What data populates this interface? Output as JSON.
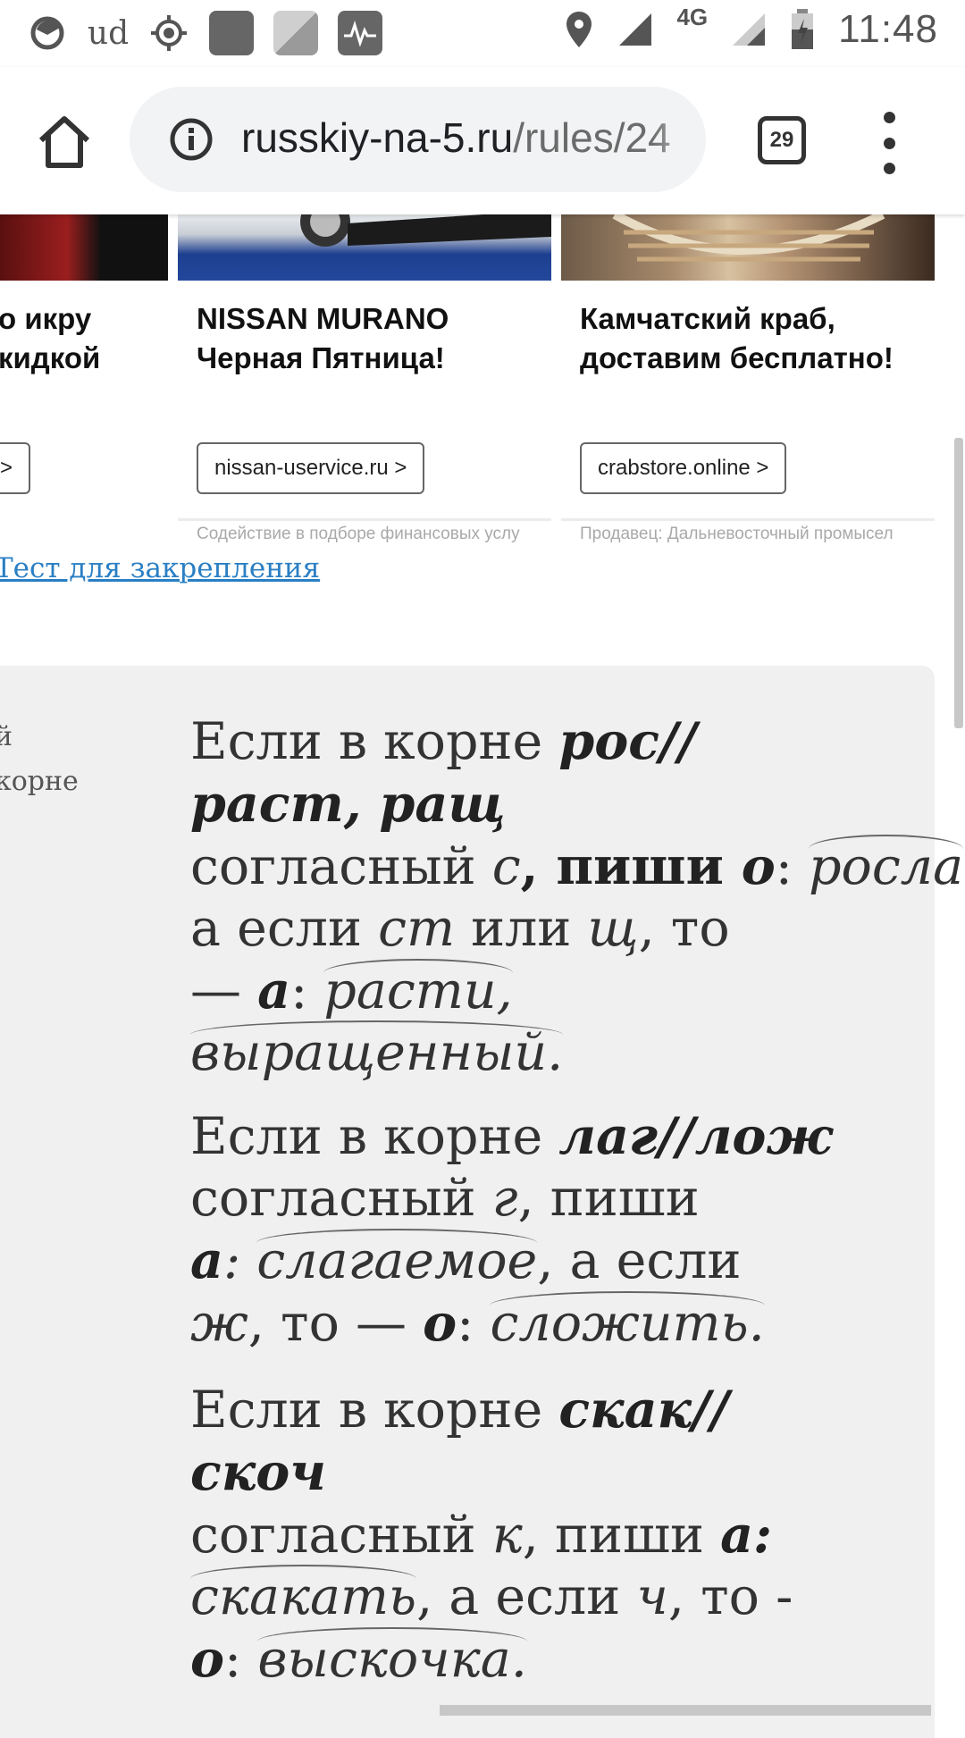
{
  "status_bar": {
    "network": "4G",
    "time": "11:48"
  },
  "toolbar": {
    "url_host": "russkiy-na-5.ru",
    "url_path": "/rules/24",
    "tab_count": "29"
  },
  "ads": [
    {
      "title_line1": "о икру",
      "title_line2": "кидкой",
      "button": ">",
      "note": ""
    },
    {
      "title_line1": "NISSAN MURANO",
      "title_line2": "Черная Пятница!",
      "button": "nissan-uservice.ru >",
      "note": "Содействие в подборе финансовых услу"
    },
    {
      "title_line1": "Камчатский краб,",
      "title_line2": "доставим бесплатно!",
      "button": "crabstore.online >",
      "note": "Продавец: Дальневосточный промысел"
    }
  ],
  "test_link": "Тест для закрепления",
  "left_column": {
    "line1": "й",
    "line2": "корне"
  },
  "rules": {
    "r1": {
      "l1_plain": "Если в корне  ",
      "l1_bold": "рос//",
      "l2_bold": "раст, ращ",
      "l3_a": "согласный ",
      "l3_b": "с",
      "l3_c": ", пиши ",
      "l3_d": "о",
      "l3_e": ": ",
      "l3_f": "росла",
      "l4_a": "а если ",
      "l4_b": "ст",
      "l4_c": " или ",
      "l4_d": "щ",
      "l4_e": ", то",
      "l5_a": " — ",
      "l5_b": "а",
      "l5_c": ": ",
      "l5_d": "расти,",
      "l6_a": "выращенный."
    },
    "r2": {
      "l1_plain": "Если в корне ",
      "l1_bold": "лаг//лож",
      "l2_a": "согласный ",
      "l2_b": "г",
      "l2_c": ", пиши",
      "l3_a": "а",
      "l3_b": ":  ",
      "l3_c": "слагаемое",
      "l3_d": ", а если",
      "l4_a": "ж",
      "l4_b": ", то — ",
      "l4_c": "о",
      "l4_d": ": ",
      "l4_e": "сложить."
    },
    "r3": {
      "l1_plain": "Если в корне ",
      "l1_bold": "скак//",
      "l2_bold": "скоч",
      "l3_a": "согласный ",
      "l3_b": "к",
      "l3_c": ", пиши ",
      "l3_d": "а:",
      "l4_a": "скакать",
      "l4_b": ", а если ",
      "l4_c": "ч",
      "l4_d": ", то -",
      "l5_a": "о",
      "l5_b": ": ",
      "l5_c": "выскочка."
    }
  }
}
